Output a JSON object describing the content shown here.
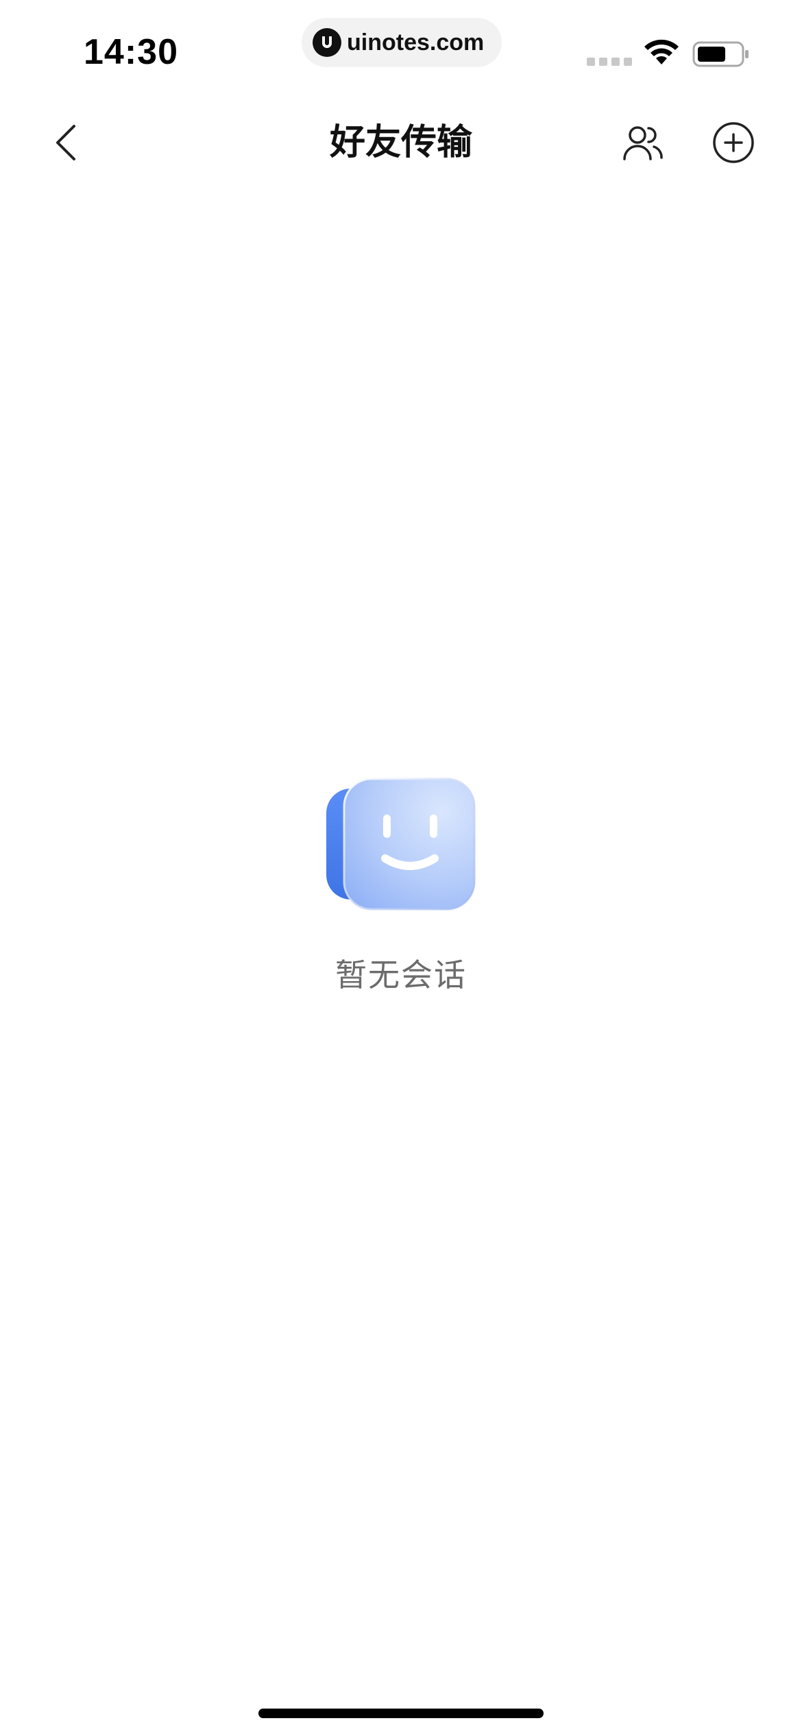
{
  "status_bar": {
    "time": "14:30",
    "url": "uinotes.com"
  },
  "nav": {
    "title": "好友传输",
    "icons": {
      "back": "chevron-left-icon",
      "friends": "users-icon",
      "add": "plus-circle-icon"
    }
  },
  "empty_state": {
    "message": "暂无会话",
    "illustration": "smiley-chat-icon"
  },
  "colors": {
    "accent_blue": "#5b8ef0",
    "text_muted": "#6b6b6b"
  }
}
